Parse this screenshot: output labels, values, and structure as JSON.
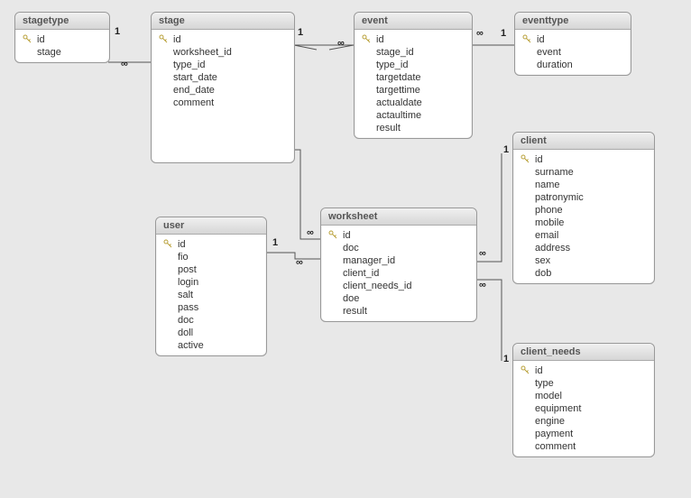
{
  "tables": {
    "stagetype": {
      "title": "stagetype",
      "fields": [
        {
          "name": "id",
          "pk": true
        },
        {
          "name": "stage",
          "pk": false
        }
      ]
    },
    "stage": {
      "title": "stage",
      "fields": [
        {
          "name": "id",
          "pk": true
        },
        {
          "name": "worksheet_id",
          "pk": false
        },
        {
          "name": "type_id",
          "pk": false
        },
        {
          "name": "start_date",
          "pk": false
        },
        {
          "name": "end_date",
          "pk": false
        },
        {
          "name": "comment",
          "pk": false
        }
      ]
    },
    "event": {
      "title": "event",
      "fields": [
        {
          "name": "id",
          "pk": true
        },
        {
          "name": "stage_id",
          "pk": false
        },
        {
          "name": "type_id",
          "pk": false
        },
        {
          "name": "targetdate",
          "pk": false
        },
        {
          "name": "targettime",
          "pk": false
        },
        {
          "name": "actualdate",
          "pk": false
        },
        {
          "name": "actaultime",
          "pk": false
        },
        {
          "name": "result",
          "pk": false
        }
      ]
    },
    "eventtype": {
      "title": "eventtype",
      "fields": [
        {
          "name": "id",
          "pk": true
        },
        {
          "name": "event",
          "pk": false
        },
        {
          "name": "duration",
          "pk": false
        }
      ]
    },
    "user": {
      "title": "user",
      "fields": [
        {
          "name": "id",
          "pk": true
        },
        {
          "name": "fio",
          "pk": false
        },
        {
          "name": "post",
          "pk": false
        },
        {
          "name": "login",
          "pk": false
        },
        {
          "name": "salt",
          "pk": false
        },
        {
          "name": "pass",
          "pk": false
        },
        {
          "name": "doc",
          "pk": false
        },
        {
          "name": "doll",
          "pk": false
        },
        {
          "name": "active",
          "pk": false
        }
      ]
    },
    "worksheet": {
      "title": "worksheet",
      "fields": [
        {
          "name": "id",
          "pk": true
        },
        {
          "name": "doc",
          "pk": false
        },
        {
          "name": "manager_id",
          "pk": false
        },
        {
          "name": "client_id",
          "pk": false
        },
        {
          "name": "client_needs_id",
          "pk": false
        },
        {
          "name": "doe",
          "pk": false
        },
        {
          "name": "result",
          "pk": false
        }
      ]
    },
    "client": {
      "title": "client",
      "fields": [
        {
          "name": "id",
          "pk": true
        },
        {
          "name": "surname",
          "pk": false
        },
        {
          "name": "name",
          "pk": false
        },
        {
          "name": "patronymic",
          "pk": false
        },
        {
          "name": "phone",
          "pk": false
        },
        {
          "name": "mobile",
          "pk": false
        },
        {
          "name": "email",
          "pk": false
        },
        {
          "name": "address",
          "pk": false
        },
        {
          "name": "sex",
          "pk": false
        },
        {
          "name": "dob",
          "pk": false
        }
      ]
    },
    "client_needs": {
      "title": "client_needs",
      "fields": [
        {
          "name": "id",
          "pk": true
        },
        {
          "name": "type",
          "pk": false
        },
        {
          "name": "model",
          "pk": false
        },
        {
          "name": "equipment",
          "pk": false
        },
        {
          "name": "engine",
          "pk": false
        },
        {
          "name": "payment",
          "pk": false
        },
        {
          "name": "comment",
          "pk": false
        }
      ]
    }
  },
  "cardinality_one": "1",
  "cardinality_many": "∞",
  "key_glyph": "🔑",
  "relationships": [
    {
      "from": "stagetype",
      "from_card": "1",
      "to": "stage",
      "to_card": "∞"
    },
    {
      "from": "stage",
      "from_card": "1",
      "to": "event",
      "to_card": "∞"
    },
    {
      "from": "event",
      "from_card": "∞",
      "to": "eventtype",
      "to_card": "1"
    },
    {
      "from": "stage",
      "from_card": "∞",
      "to": "worksheet",
      "to_card": "1"
    },
    {
      "from": "user",
      "from_card": "1",
      "to": "worksheet",
      "to_card": "∞"
    },
    {
      "from": "worksheet",
      "from_card": "∞",
      "to": "client",
      "to_card": "1"
    },
    {
      "from": "worksheet",
      "from_card": "∞",
      "to": "client_needs",
      "to_card": "1"
    }
  ]
}
